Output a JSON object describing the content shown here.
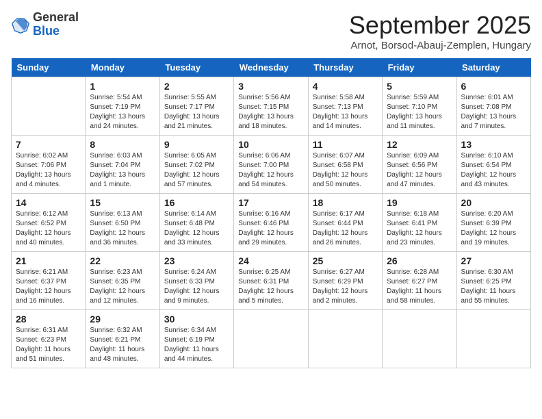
{
  "header": {
    "logo_general": "General",
    "logo_blue": "Blue",
    "month": "September 2025",
    "location": "Arnot, Borsod-Abauj-Zemplen, Hungary"
  },
  "days_of_week": [
    "Sunday",
    "Monday",
    "Tuesday",
    "Wednesday",
    "Thursday",
    "Friday",
    "Saturday"
  ],
  "weeks": [
    [
      {
        "day": "",
        "info": ""
      },
      {
        "day": "1",
        "info": "Sunrise: 5:54 AM\nSunset: 7:19 PM\nDaylight: 13 hours\nand 24 minutes."
      },
      {
        "day": "2",
        "info": "Sunrise: 5:55 AM\nSunset: 7:17 PM\nDaylight: 13 hours\nand 21 minutes."
      },
      {
        "day": "3",
        "info": "Sunrise: 5:56 AM\nSunset: 7:15 PM\nDaylight: 13 hours\nand 18 minutes."
      },
      {
        "day": "4",
        "info": "Sunrise: 5:58 AM\nSunset: 7:13 PM\nDaylight: 13 hours\nand 14 minutes."
      },
      {
        "day": "5",
        "info": "Sunrise: 5:59 AM\nSunset: 7:10 PM\nDaylight: 13 hours\nand 11 minutes."
      },
      {
        "day": "6",
        "info": "Sunrise: 6:01 AM\nSunset: 7:08 PM\nDaylight: 13 hours\nand 7 minutes."
      }
    ],
    [
      {
        "day": "7",
        "info": "Sunrise: 6:02 AM\nSunset: 7:06 PM\nDaylight: 13 hours\nand 4 minutes."
      },
      {
        "day": "8",
        "info": "Sunrise: 6:03 AM\nSunset: 7:04 PM\nDaylight: 13 hours\nand 1 minute."
      },
      {
        "day": "9",
        "info": "Sunrise: 6:05 AM\nSunset: 7:02 PM\nDaylight: 12 hours\nand 57 minutes."
      },
      {
        "day": "10",
        "info": "Sunrise: 6:06 AM\nSunset: 7:00 PM\nDaylight: 12 hours\nand 54 minutes."
      },
      {
        "day": "11",
        "info": "Sunrise: 6:07 AM\nSunset: 6:58 PM\nDaylight: 12 hours\nand 50 minutes."
      },
      {
        "day": "12",
        "info": "Sunrise: 6:09 AM\nSunset: 6:56 PM\nDaylight: 12 hours\nand 47 minutes."
      },
      {
        "day": "13",
        "info": "Sunrise: 6:10 AM\nSunset: 6:54 PM\nDaylight: 12 hours\nand 43 minutes."
      }
    ],
    [
      {
        "day": "14",
        "info": "Sunrise: 6:12 AM\nSunset: 6:52 PM\nDaylight: 12 hours\nand 40 minutes."
      },
      {
        "day": "15",
        "info": "Sunrise: 6:13 AM\nSunset: 6:50 PM\nDaylight: 12 hours\nand 36 minutes."
      },
      {
        "day": "16",
        "info": "Sunrise: 6:14 AM\nSunset: 6:48 PM\nDaylight: 12 hours\nand 33 minutes."
      },
      {
        "day": "17",
        "info": "Sunrise: 6:16 AM\nSunset: 6:46 PM\nDaylight: 12 hours\nand 29 minutes."
      },
      {
        "day": "18",
        "info": "Sunrise: 6:17 AM\nSunset: 6:44 PM\nDaylight: 12 hours\nand 26 minutes."
      },
      {
        "day": "19",
        "info": "Sunrise: 6:18 AM\nSunset: 6:41 PM\nDaylight: 12 hours\nand 23 minutes."
      },
      {
        "day": "20",
        "info": "Sunrise: 6:20 AM\nSunset: 6:39 PM\nDaylight: 12 hours\nand 19 minutes."
      }
    ],
    [
      {
        "day": "21",
        "info": "Sunrise: 6:21 AM\nSunset: 6:37 PM\nDaylight: 12 hours\nand 16 minutes."
      },
      {
        "day": "22",
        "info": "Sunrise: 6:23 AM\nSunset: 6:35 PM\nDaylight: 12 hours\nand 12 minutes."
      },
      {
        "day": "23",
        "info": "Sunrise: 6:24 AM\nSunset: 6:33 PM\nDaylight: 12 hours\nand 9 minutes."
      },
      {
        "day": "24",
        "info": "Sunrise: 6:25 AM\nSunset: 6:31 PM\nDaylight: 12 hours\nand 5 minutes."
      },
      {
        "day": "25",
        "info": "Sunrise: 6:27 AM\nSunset: 6:29 PM\nDaylight: 12 hours\nand 2 minutes."
      },
      {
        "day": "26",
        "info": "Sunrise: 6:28 AM\nSunset: 6:27 PM\nDaylight: 11 hours\nand 58 minutes."
      },
      {
        "day": "27",
        "info": "Sunrise: 6:30 AM\nSunset: 6:25 PM\nDaylight: 11 hours\nand 55 minutes."
      }
    ],
    [
      {
        "day": "28",
        "info": "Sunrise: 6:31 AM\nSunset: 6:23 PM\nDaylight: 11 hours\nand 51 minutes."
      },
      {
        "day": "29",
        "info": "Sunrise: 6:32 AM\nSunset: 6:21 PM\nDaylight: 11 hours\nand 48 minutes."
      },
      {
        "day": "30",
        "info": "Sunrise: 6:34 AM\nSunset: 6:19 PM\nDaylight: 11 hours\nand 44 minutes."
      },
      {
        "day": "",
        "info": ""
      },
      {
        "day": "",
        "info": ""
      },
      {
        "day": "",
        "info": ""
      },
      {
        "day": "",
        "info": ""
      }
    ]
  ]
}
